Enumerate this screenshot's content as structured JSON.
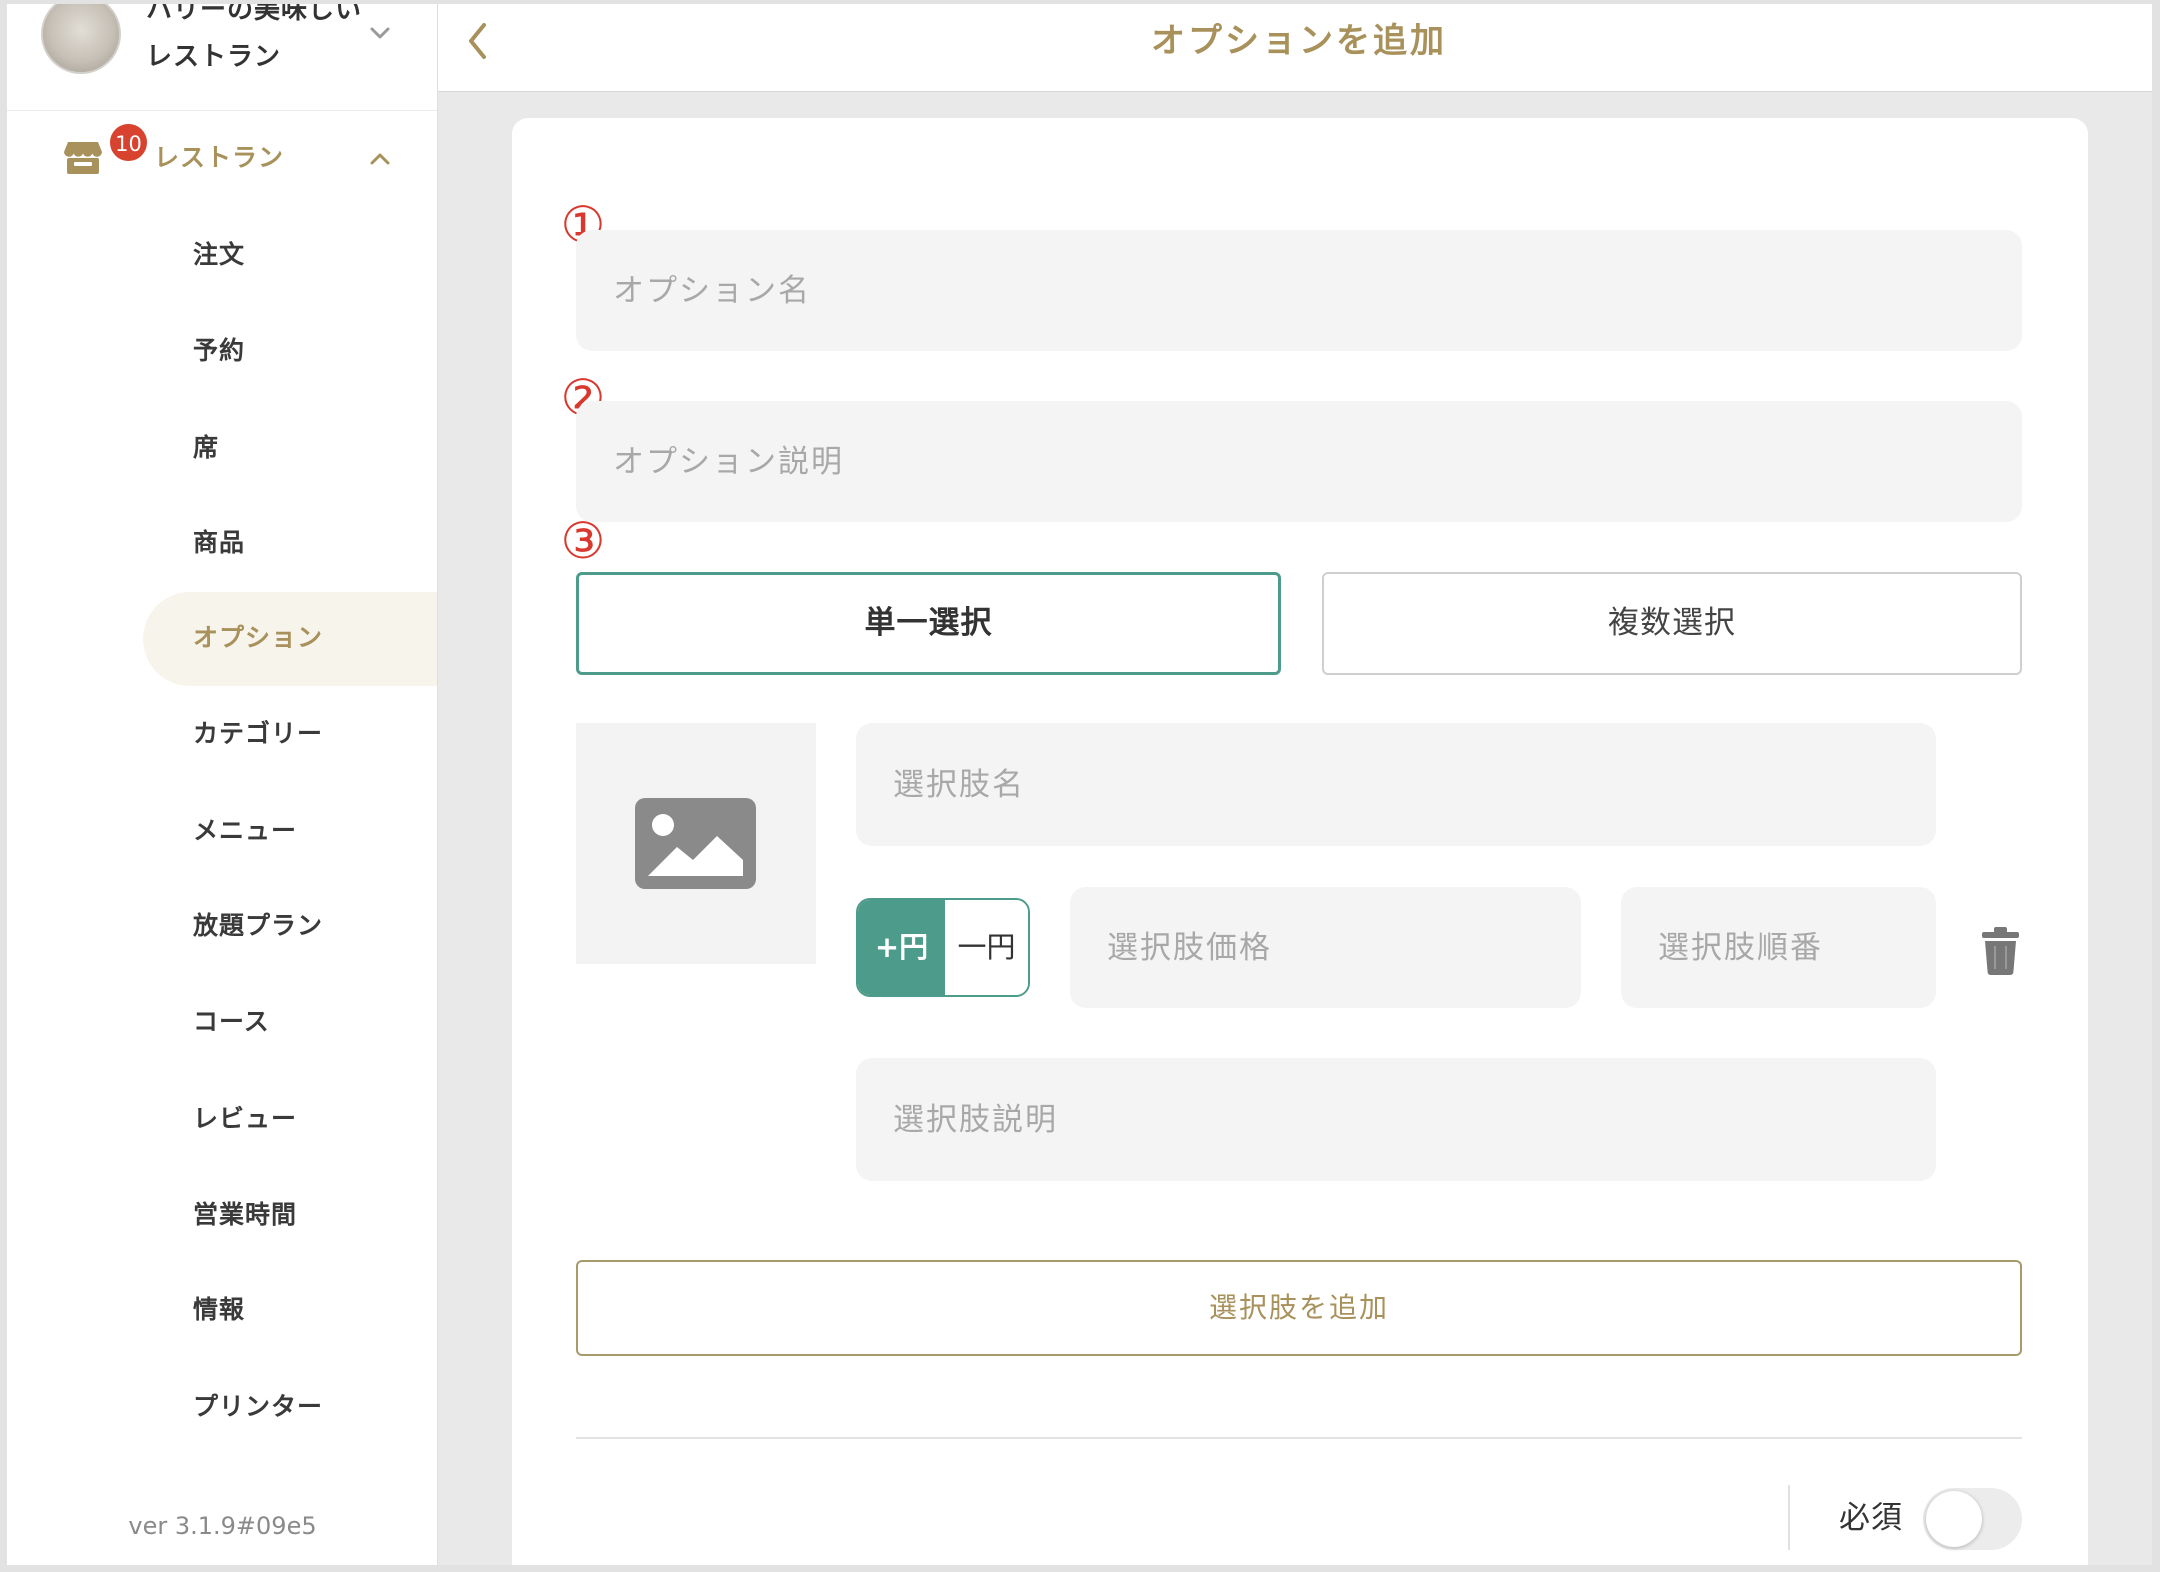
{
  "header": {
    "title": "オプションを追加",
    "back_icon": "chevron-left-icon"
  },
  "sidebar": {
    "restaurant_name_lines": [
      "ハリーの美味しい",
      "レストラン"
    ],
    "switcher_icon": "chevron-down-icon",
    "nav": {
      "section_label": "レストラン",
      "section_icon": "store-icon",
      "badge": "10",
      "collapse_icon": "chevron-up-icon",
      "items": [
        "注文",
        "予約",
        "席",
        "商品",
        "オプション",
        "カテゴリー",
        "メニュー",
        "放題プラン",
        "コース",
        "レビュー",
        "営業時間",
        "情報",
        "プリンター"
      ],
      "active_index": 4
    },
    "version": "ver 3.1.9#09e5"
  },
  "form": {
    "annotations": [
      "①",
      "②",
      "③"
    ],
    "option_name": {
      "placeholder": "オプション名"
    },
    "option_description": {
      "placeholder": "オプション説明"
    },
    "selection_type": {
      "options": [
        "単一選択",
        "複数選択"
      ],
      "selected_index": 0
    },
    "choice": {
      "image_icon": "image-placeholder-icon",
      "name": {
        "placeholder": "選択肢名"
      },
      "price_mode": {
        "options": [
          "+円",
          "一円"
        ],
        "selected_index": 0
      },
      "price": {
        "placeholder": "選択肢価格"
      },
      "order": {
        "placeholder": "選択肢順番"
      },
      "description": {
        "placeholder": "選択肢説明"
      },
      "delete_icon": "trash-icon"
    },
    "add_choice_label": "選択肢を追加",
    "required": {
      "label": "必須",
      "enabled": false
    }
  },
  "colors": {
    "accent_gold": "#a8915a",
    "teal": "#4d9b8b",
    "badge_red": "#d8432f",
    "active_bg": "#f7f4ec",
    "background": "#e9e9e9"
  }
}
